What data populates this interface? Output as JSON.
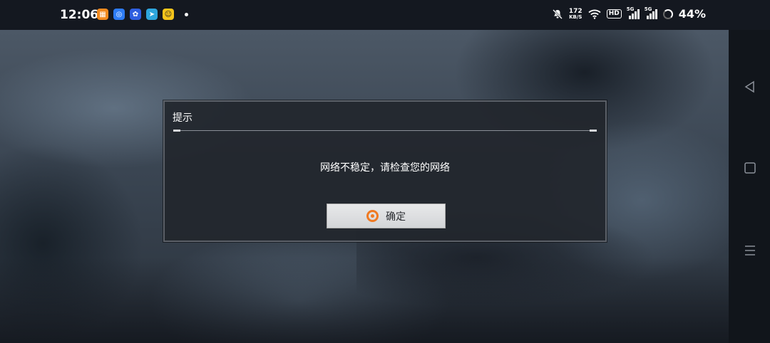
{
  "status_bar": {
    "time": "12:06",
    "net_speed_value": "172",
    "net_speed_unit": "KB/S",
    "hd_label": "HD",
    "sim1_tag": "5G",
    "sim2_tag": "5G",
    "battery": "44%",
    "apps": [
      "calendar-app-icon",
      "browser-app-icon",
      "baidu-app-icon",
      "telegram-app-icon",
      "qq-app-icon"
    ]
  },
  "dialog": {
    "title": "提示",
    "message": "网络不稳定，请检查您的网络",
    "confirm_label": "确定",
    "accent_color": "#f07a22"
  }
}
